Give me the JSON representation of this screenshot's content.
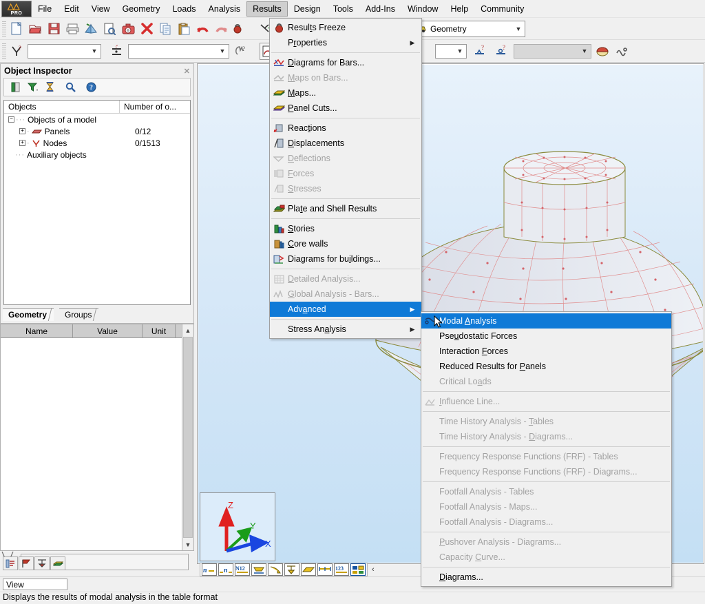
{
  "app": {
    "logo_mark": "A",
    "logo_sub": "PRO"
  },
  "menubar": {
    "items": [
      {
        "label": "File",
        "active": false
      },
      {
        "label": "Edit",
        "active": false
      },
      {
        "label": "View",
        "active": false
      },
      {
        "label": "Geometry",
        "active": false
      },
      {
        "label": "Loads",
        "active": false
      },
      {
        "label": "Analysis",
        "active": false
      },
      {
        "label": "Results",
        "active": true
      },
      {
        "label": "Design",
        "active": false
      },
      {
        "label": "Tools",
        "active": false
      },
      {
        "label": "Add-Ins",
        "active": false
      },
      {
        "label": "Window",
        "active": false
      },
      {
        "label": "Help",
        "active": false
      },
      {
        "label": "Community",
        "active": false
      }
    ]
  },
  "toolbar_top": {
    "buttons": [
      {
        "name": "new-file-icon"
      },
      {
        "name": "open-file-icon"
      },
      {
        "name": "save-icon"
      },
      {
        "name": "print-icon"
      },
      {
        "name": "print-preview-icon"
      },
      {
        "name": "printout-composition-icon"
      },
      {
        "name": "screen-capture-icon"
      },
      {
        "name": "delete-icon"
      },
      {
        "name": "copy-icon"
      },
      {
        "name": "paste-icon"
      },
      {
        "name": "undo-icon"
      },
      {
        "name": "redo-icon"
      },
      {
        "name": "results-freeze-icon"
      },
      {
        "name": "display-icon"
      },
      {
        "name": "zoom-window-icon"
      },
      {
        "name": "zoom-out-icon"
      },
      {
        "name": "initial-view-icon"
      },
      {
        "name": "3d-view-icon"
      },
      {
        "name": "rotate-icon"
      },
      {
        "name": "job-preferences-icon"
      },
      {
        "name": "tables-icon"
      }
    ],
    "selector": {
      "value": "Geometry",
      "icon": "geometry-icon"
    }
  },
  "toolbar_second": {
    "node_field_placeholder": "",
    "node_field_value": "",
    "bar_field_placeholder": "",
    "bar_field_value": "",
    "case_field_value": "",
    "buttons": [
      {
        "name": "node-query-icon"
      },
      {
        "name": "bar-query-icon"
      },
      {
        "name": "hand-query-icon"
      },
      {
        "name": "view-icon"
      },
      {
        "name": "panel-icon"
      },
      {
        "name": "support-query-icon"
      },
      {
        "name": "release-query-icon"
      },
      {
        "name": "color-map-icon"
      },
      {
        "name": "wave-icon"
      }
    ]
  },
  "inspector": {
    "title": "Object Inspector",
    "close_label": "✕",
    "toolbar": [
      {
        "name": "save-layout-icon"
      },
      {
        "name": "filter-icon"
      },
      {
        "name": "hourglass-icon"
      },
      {
        "name": "search-icon"
      },
      {
        "name": "help-icon"
      }
    ],
    "columns": [
      "Objects",
      "Number of o..."
    ],
    "rows": [
      {
        "indent": 0,
        "expander": "−",
        "icon": "",
        "label": "Objects of a model",
        "count": ""
      },
      {
        "indent": 1,
        "expander": "+",
        "icon": "panel-icon",
        "label": "Panels",
        "count": "0/12"
      },
      {
        "indent": 1,
        "expander": "+",
        "icon": "node-icon",
        "label": "Nodes",
        "count": "0/1513"
      },
      {
        "indent": 0,
        "expander": "",
        "icon": "",
        "label": "Auxiliary objects",
        "count": ""
      }
    ],
    "tabs": [
      {
        "label": "Geometry",
        "selected": true
      },
      {
        "label": "Groups",
        "selected": false
      }
    ]
  },
  "properties": {
    "columns": [
      "Name",
      "Value",
      "Unit"
    ],
    "rows": [],
    "bottom_buttons": [
      {
        "name": "properties-list-icon"
      },
      {
        "name": "panel-flag-icon"
      },
      {
        "name": "section-icon"
      },
      {
        "name": "layers-icon"
      }
    ]
  },
  "view": {
    "model_name": "water-tower-model",
    "axis": {
      "z_label": "Z",
      "y_label": "Y",
      "x_label": "X",
      "z_color": "#e02020",
      "y_color": "#1a9c1a",
      "x_color": "#1a46e0"
    },
    "bottom_toolbar_buttons": [
      {
        "name": "node-numbers-icon",
        "glyph": "n"
      },
      {
        "name": "bar-numbers-icon",
        "glyph": "n"
      },
      {
        "name": "panel-numbers-icon",
        "glyph": "N12"
      },
      {
        "name": "supports-display-icon",
        "glyph": ""
      },
      {
        "name": "loads-display-icon",
        "glyph": ""
      },
      {
        "name": "section-shapes-icon",
        "glyph": ""
      },
      {
        "name": "panel-display-icon",
        "glyph": ""
      },
      {
        "name": "dimension-lines-icon",
        "glyph": ""
      },
      {
        "name": "numeric-values-icon",
        "glyph": "123"
      },
      {
        "name": "display-settings-icon",
        "glyph": ""
      }
    ],
    "more_chevron": "‹"
  },
  "statusbar": {
    "view_label": "View",
    "message": "Displays the results of modal analysis in the table format"
  },
  "results_menu": {
    "items": [
      {
        "label": "Results Freeze",
        "icon": "freeze-icon",
        "disabled": false,
        "submenu": false,
        "sep_after": false,
        "accel": 5
      },
      {
        "label": "Properties",
        "icon": "",
        "disabled": false,
        "submenu": true,
        "sep_after": true,
        "accel": 1
      },
      {
        "label": "Diagrams for Bars...",
        "icon": "diagrams-bars-icon",
        "disabled": false,
        "submenu": false,
        "sep_after": false,
        "accel": 0
      },
      {
        "label": "Maps on Bars...",
        "icon": "maps-bars-icon",
        "disabled": true,
        "submenu": false,
        "sep_after": false,
        "accel": 0
      },
      {
        "label": "Maps...",
        "icon": "maps-icon",
        "disabled": false,
        "submenu": false,
        "sep_after": false,
        "accel": 0
      },
      {
        "label": "Panel Cuts...",
        "icon": "panel-cuts-icon",
        "disabled": false,
        "submenu": false,
        "sep_after": true,
        "accel": 0
      },
      {
        "label": "Reactions",
        "icon": "reactions-icon",
        "disabled": false,
        "submenu": false,
        "sep_after": false,
        "accel": 4
      },
      {
        "label": "Displacements",
        "icon": "displacements-icon",
        "disabled": false,
        "submenu": false,
        "sep_after": false,
        "accel": 0
      },
      {
        "label": "Deflections",
        "icon": "deflections-icon",
        "disabled": true,
        "submenu": false,
        "sep_after": false,
        "accel": 0
      },
      {
        "label": "Forces",
        "icon": "forces-icon",
        "disabled": true,
        "submenu": false,
        "sep_after": false,
        "accel": 0
      },
      {
        "label": "Stresses",
        "icon": "stresses-icon",
        "disabled": true,
        "submenu": false,
        "sep_after": true,
        "accel": 0
      },
      {
        "label": "Plate and Shell Results",
        "icon": "plate-shell-icon",
        "disabled": false,
        "submenu": false,
        "sep_after": true,
        "accel": 3
      },
      {
        "label": "Stories",
        "icon": "stories-icon",
        "disabled": false,
        "submenu": false,
        "sep_after": false,
        "accel": 0
      },
      {
        "label": "Core walls",
        "icon": "core-walls-icon",
        "disabled": false,
        "submenu": false,
        "sep_after": false,
        "accel": 0
      },
      {
        "label": "Diagrams for buildings...",
        "icon": "diagrams-buildings-icon",
        "disabled": false,
        "submenu": false,
        "sep_after": true,
        "accel": 15
      },
      {
        "label": "Detailed Analysis...",
        "icon": "detailed-analysis-icon",
        "disabled": true,
        "submenu": false,
        "sep_after": false,
        "accel": 0
      },
      {
        "label": "Global Analysis - Bars...",
        "icon": "global-analysis-icon",
        "disabled": true,
        "submenu": false,
        "sep_after": false,
        "accel": 0
      },
      {
        "label": "Advanced",
        "icon": "",
        "disabled": false,
        "submenu": true,
        "sep_after": true,
        "accel": 3,
        "selected": true
      },
      {
        "label": "Stress Analysis",
        "icon": "",
        "disabled": false,
        "submenu": true,
        "sep_after": false,
        "accel": 9
      }
    ]
  },
  "advanced_menu": {
    "items": [
      {
        "label": "Modal Analysis",
        "icon": "modal-analysis-icon",
        "disabled": false,
        "selected": true,
        "sep_after": false,
        "accel": 6
      },
      {
        "label": "Pseudostatic Forces",
        "icon": "",
        "disabled": false,
        "selected": false,
        "sep_after": false,
        "accel": 3
      },
      {
        "label": "Interaction Forces",
        "icon": "",
        "disabled": false,
        "selected": false,
        "sep_after": false,
        "accel": 12
      },
      {
        "label": "Reduced Results for Panels",
        "icon": "",
        "disabled": false,
        "selected": false,
        "sep_after": false,
        "accel": 20
      },
      {
        "label": "Critical Loads",
        "icon": "",
        "disabled": true,
        "selected": false,
        "sep_after": true,
        "accel": 11
      },
      {
        "label": "Influence Line...",
        "icon": "influence-line-icon",
        "disabled": true,
        "selected": false,
        "sep_after": true,
        "accel": 0
      },
      {
        "label": "Time History Analysis - Tables",
        "icon": "",
        "disabled": true,
        "selected": false,
        "sep_after": false,
        "accel": 24
      },
      {
        "label": "Time History Analysis - Diagrams...",
        "icon": "",
        "disabled": true,
        "selected": false,
        "sep_after": true,
        "accel": 24
      },
      {
        "label": "Frequency Response Functions (FRF) - Tables",
        "icon": "",
        "disabled": true,
        "selected": false,
        "sep_after": false,
        "accel": -1
      },
      {
        "label": "Frequency Response Functions (FRF) - Diagrams...",
        "icon": "",
        "disabled": true,
        "selected": false,
        "sep_after": true,
        "accel": -1
      },
      {
        "label": "Footfall Analysis - Tables",
        "icon": "",
        "disabled": true,
        "selected": false,
        "sep_after": false,
        "accel": -1
      },
      {
        "label": "Footfall Analysis - Maps...",
        "icon": "",
        "disabled": true,
        "selected": false,
        "sep_after": false,
        "accel": -1
      },
      {
        "label": "Footfall Analysis - Diagrams...",
        "icon": "",
        "disabled": true,
        "selected": false,
        "sep_after": true,
        "accel": -1
      },
      {
        "label": "Pushover Analysis - Diagrams...",
        "icon": "",
        "disabled": true,
        "selected": false,
        "sep_after": false,
        "accel": 0
      },
      {
        "label": "Capacity Curve...",
        "icon": "",
        "disabled": true,
        "selected": false,
        "sep_after": true,
        "accel": 9
      },
      {
        "label": "Diagrams...",
        "icon": "",
        "disabled": false,
        "selected": false,
        "sep_after": false,
        "accel": 0
      }
    ]
  },
  "colors": {
    "menu_highlight": "#0f7ad7",
    "menu_bg": "#f0f0f0",
    "view_bg_top": "#e8f2fb",
    "view_bg_bottom": "#c4dff4",
    "model_mesh": "#e08b8b",
    "model_edge": "#8a8a3c"
  }
}
